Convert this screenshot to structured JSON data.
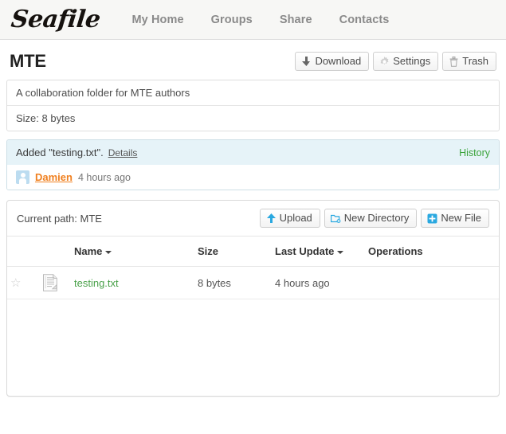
{
  "brand": {
    "logo_text": "Seafile"
  },
  "nav": {
    "items": [
      {
        "label": "My Home",
        "name": "nav-my-home"
      },
      {
        "label": "Groups",
        "name": "nav-groups"
      },
      {
        "label": "Share",
        "name": "nav-share"
      },
      {
        "label": "Contacts",
        "name": "nav-contacts"
      }
    ]
  },
  "repo": {
    "title": "MTE",
    "description": "A collaboration folder for MTE authors",
    "size_label": "Size: 8 bytes",
    "actions": [
      {
        "label": "Download",
        "icon": "download-arrow-icon"
      },
      {
        "label": "Settings",
        "icon": "gear-icon"
      },
      {
        "label": "Trash",
        "icon": "trash-icon"
      }
    ]
  },
  "activity": {
    "message": "Added \"testing.txt\".",
    "details_label": "Details",
    "history_label": "History",
    "author": "Damien",
    "time": "4 hours ago"
  },
  "filelist": {
    "current_path_label": "Current path: MTE",
    "toolbar": [
      {
        "label": "Upload",
        "icon": "upload-arrow-icon"
      },
      {
        "label": "New Directory",
        "icon": "new-folder-icon"
      },
      {
        "label": "New File",
        "icon": "new-file-icon"
      }
    ],
    "columns": [
      {
        "label": "Name",
        "sortable": true
      },
      {
        "label": "Size",
        "sortable": false
      },
      {
        "label": "Last Update",
        "sortable": true
      },
      {
        "label": "Operations",
        "sortable": false
      }
    ],
    "rows": [
      {
        "name": "testing.txt",
        "size": "8 bytes",
        "last_update": "4 hours ago",
        "operations": "",
        "starred": false,
        "icon": "text-file-icon"
      }
    ]
  },
  "colors": {
    "brand_green": "#4aa14a",
    "accent_blue": "#29a8e0",
    "username_orange": "#f08020",
    "activity_bg": "#e6f3f8"
  }
}
